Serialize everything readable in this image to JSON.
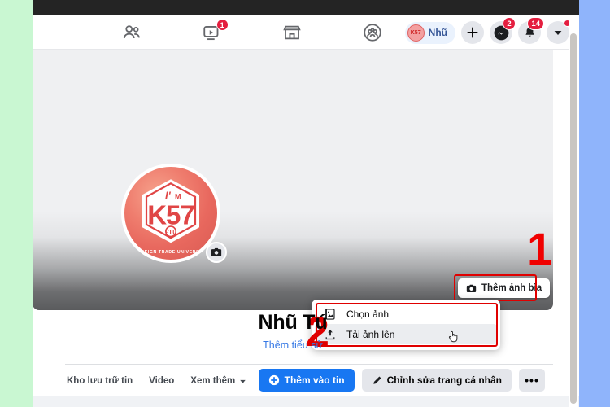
{
  "window": {
    "left_margin_color": "#c9f7d2",
    "right_margin_color": "#8fb4fb",
    "topbar_color": "#242424"
  },
  "header": {
    "nav_items": [
      {
        "name": "friends-icon",
        "label": "Bạn bè",
        "badge": null
      },
      {
        "name": "watch-icon",
        "label": "Video",
        "badge": "1"
      },
      {
        "name": "marketplace-icon",
        "label": "Marketplace",
        "badge": null
      },
      {
        "name": "groups-icon",
        "label": "Nhóm",
        "badge": null
      }
    ],
    "profile_pill": {
      "name": "Nhũ",
      "avatar_text": "K57"
    },
    "create_button": {
      "label": "+"
    },
    "messenger": {
      "badge": "2"
    },
    "notifications": {
      "badge": "14"
    },
    "account_menu": {
      "has_dot": true
    }
  },
  "cover": {
    "add_cover_button": {
      "label": "Thêm ảnh bìa",
      "icon": "camera-icon"
    },
    "annotation_marker": "1"
  },
  "dropdown": {
    "items": [
      {
        "label": "Chọn ảnh",
        "icon": "photo-icon",
        "hovered": false
      },
      {
        "label": "Tải ảnh lên",
        "icon": "upload-icon",
        "hovered": true
      }
    ],
    "annotation_marker": "2",
    "cursor": "hand-cursor"
  },
  "profile": {
    "avatar": {
      "im_text": "I'M",
      "k57_text": "K57",
      "fto_text": "FTU",
      "university_text": "FOREIGN TRADE UNIVERSITY"
    },
    "avatar_camera_button": {
      "icon": "camera-icon"
    },
    "name": "Nhũ Tú",
    "bio_link": "Thêm tiểu sử"
  },
  "bottom_nav": {
    "tabs": [
      {
        "label": "Kho lưu trữ tin",
        "has_chevron": false
      },
      {
        "label": "Video",
        "has_chevron": false
      },
      {
        "label": "Xem thêm",
        "has_chevron": true
      }
    ],
    "actions": {
      "add_story": {
        "label": "Thêm vào tin",
        "icon": "plus-circle-icon",
        "color": "#1877f2"
      },
      "edit_profile": {
        "label": "Chỉnh sửa trang cá nhân",
        "icon": "pencil-icon"
      },
      "more": {
        "label": "•••"
      }
    }
  }
}
